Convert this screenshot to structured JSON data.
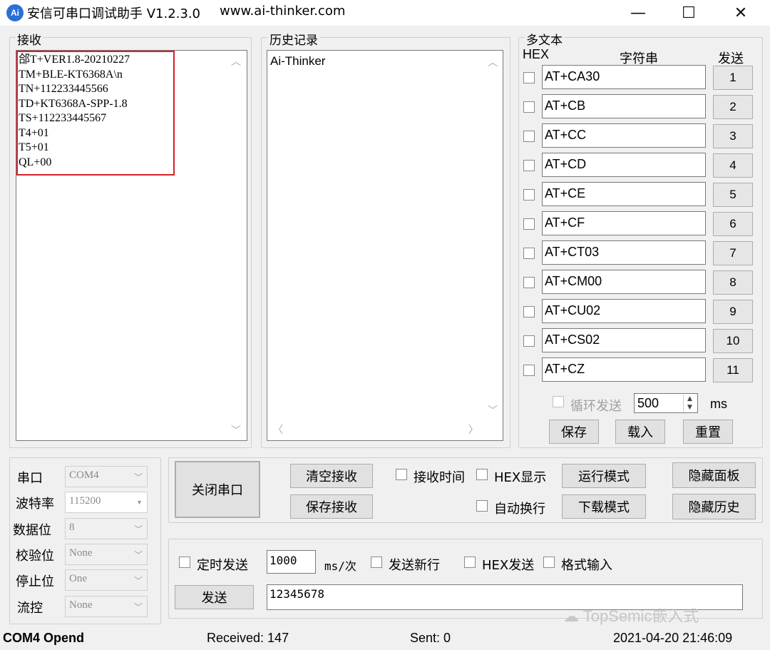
{
  "window": {
    "icon_text": "Ai",
    "title": "安信可串口调试助手 V1.2.3.0",
    "url": "www.ai-thinker.com",
    "minimize": "—",
    "maximize": "☐",
    "close": "✕"
  },
  "receive": {
    "label": "接收",
    "lines": [
      "郃T+VER1.8-20210227",
      "TM+BLE-KT6368A\\n",
      "TN+112233445566",
      "TD+KT6368A-SPP-1.8",
      "TS+112233445567",
      "T4+01",
      "T5+01",
      "QL+00"
    ],
    "highlight_color": "#d6202a"
  },
  "history": {
    "label": "历史记录",
    "items": [
      "Ai-Thinker"
    ]
  },
  "multitext": {
    "label": "多文本",
    "hex_header": "HEX",
    "string_header": "字符串",
    "send_header": "发送",
    "rows": [
      {
        "cmd": "AT+CA30",
        "num": "1"
      },
      {
        "cmd": "AT+CB",
        "num": "2"
      },
      {
        "cmd": "AT+CC",
        "num": "3"
      },
      {
        "cmd": "AT+CD",
        "num": "4"
      },
      {
        "cmd": "AT+CE",
        "num": "5"
      },
      {
        "cmd": "AT+CF",
        "num": "6"
      },
      {
        "cmd": "AT+CT03",
        "num": "7"
      },
      {
        "cmd": "AT+CM00",
        "num": "8"
      },
      {
        "cmd": "AT+CU02",
        "num": "9"
      },
      {
        "cmd": "AT+CS02",
        "num": "10"
      },
      {
        "cmd": "AT+CZ",
        "num": "11"
      }
    ],
    "loop_send_label": "循环发送",
    "loop_interval": "500",
    "ms_label": "ms",
    "save_label": "保存",
    "load_label": "载入",
    "reset_label": "重置"
  },
  "port_settings": {
    "port_label": "串口",
    "port_value": "COM4",
    "baud_label": "波特率",
    "baud_value": "115200",
    "databits_label": "数据位",
    "databits_value": "8",
    "parity_label": "校验位",
    "parity_value": "None",
    "stopbits_label": "停止位",
    "stopbits_value": "One",
    "flow_label": "流控",
    "flow_value": "None"
  },
  "controls": {
    "close_port": "关闭串口",
    "clear_receive": "清空接收",
    "save_receive": "保存接收",
    "receive_time": "接收时间",
    "hex_display": "HEX显示",
    "auto_newline": "自动换行",
    "run_mode": "运行模式",
    "download_mode": "下载模式",
    "hide_panel": "隐藏面板",
    "hide_history": "隐藏历史"
  },
  "send": {
    "timed_send": "定时发送",
    "interval": "1000",
    "unit": "ms/次",
    "send_newline": "发送新行",
    "hex_send": "HEX发送",
    "format_input": "格式输入",
    "send_button": "发送",
    "input_value": "12345678"
  },
  "status": {
    "port_status": "COM4 Opend",
    "received": "Received: 147",
    "sent": "Sent: 0",
    "datetime": "2021-04-20 21:46:09"
  },
  "watermark": {
    "text": "TopSemic嵌入式"
  }
}
